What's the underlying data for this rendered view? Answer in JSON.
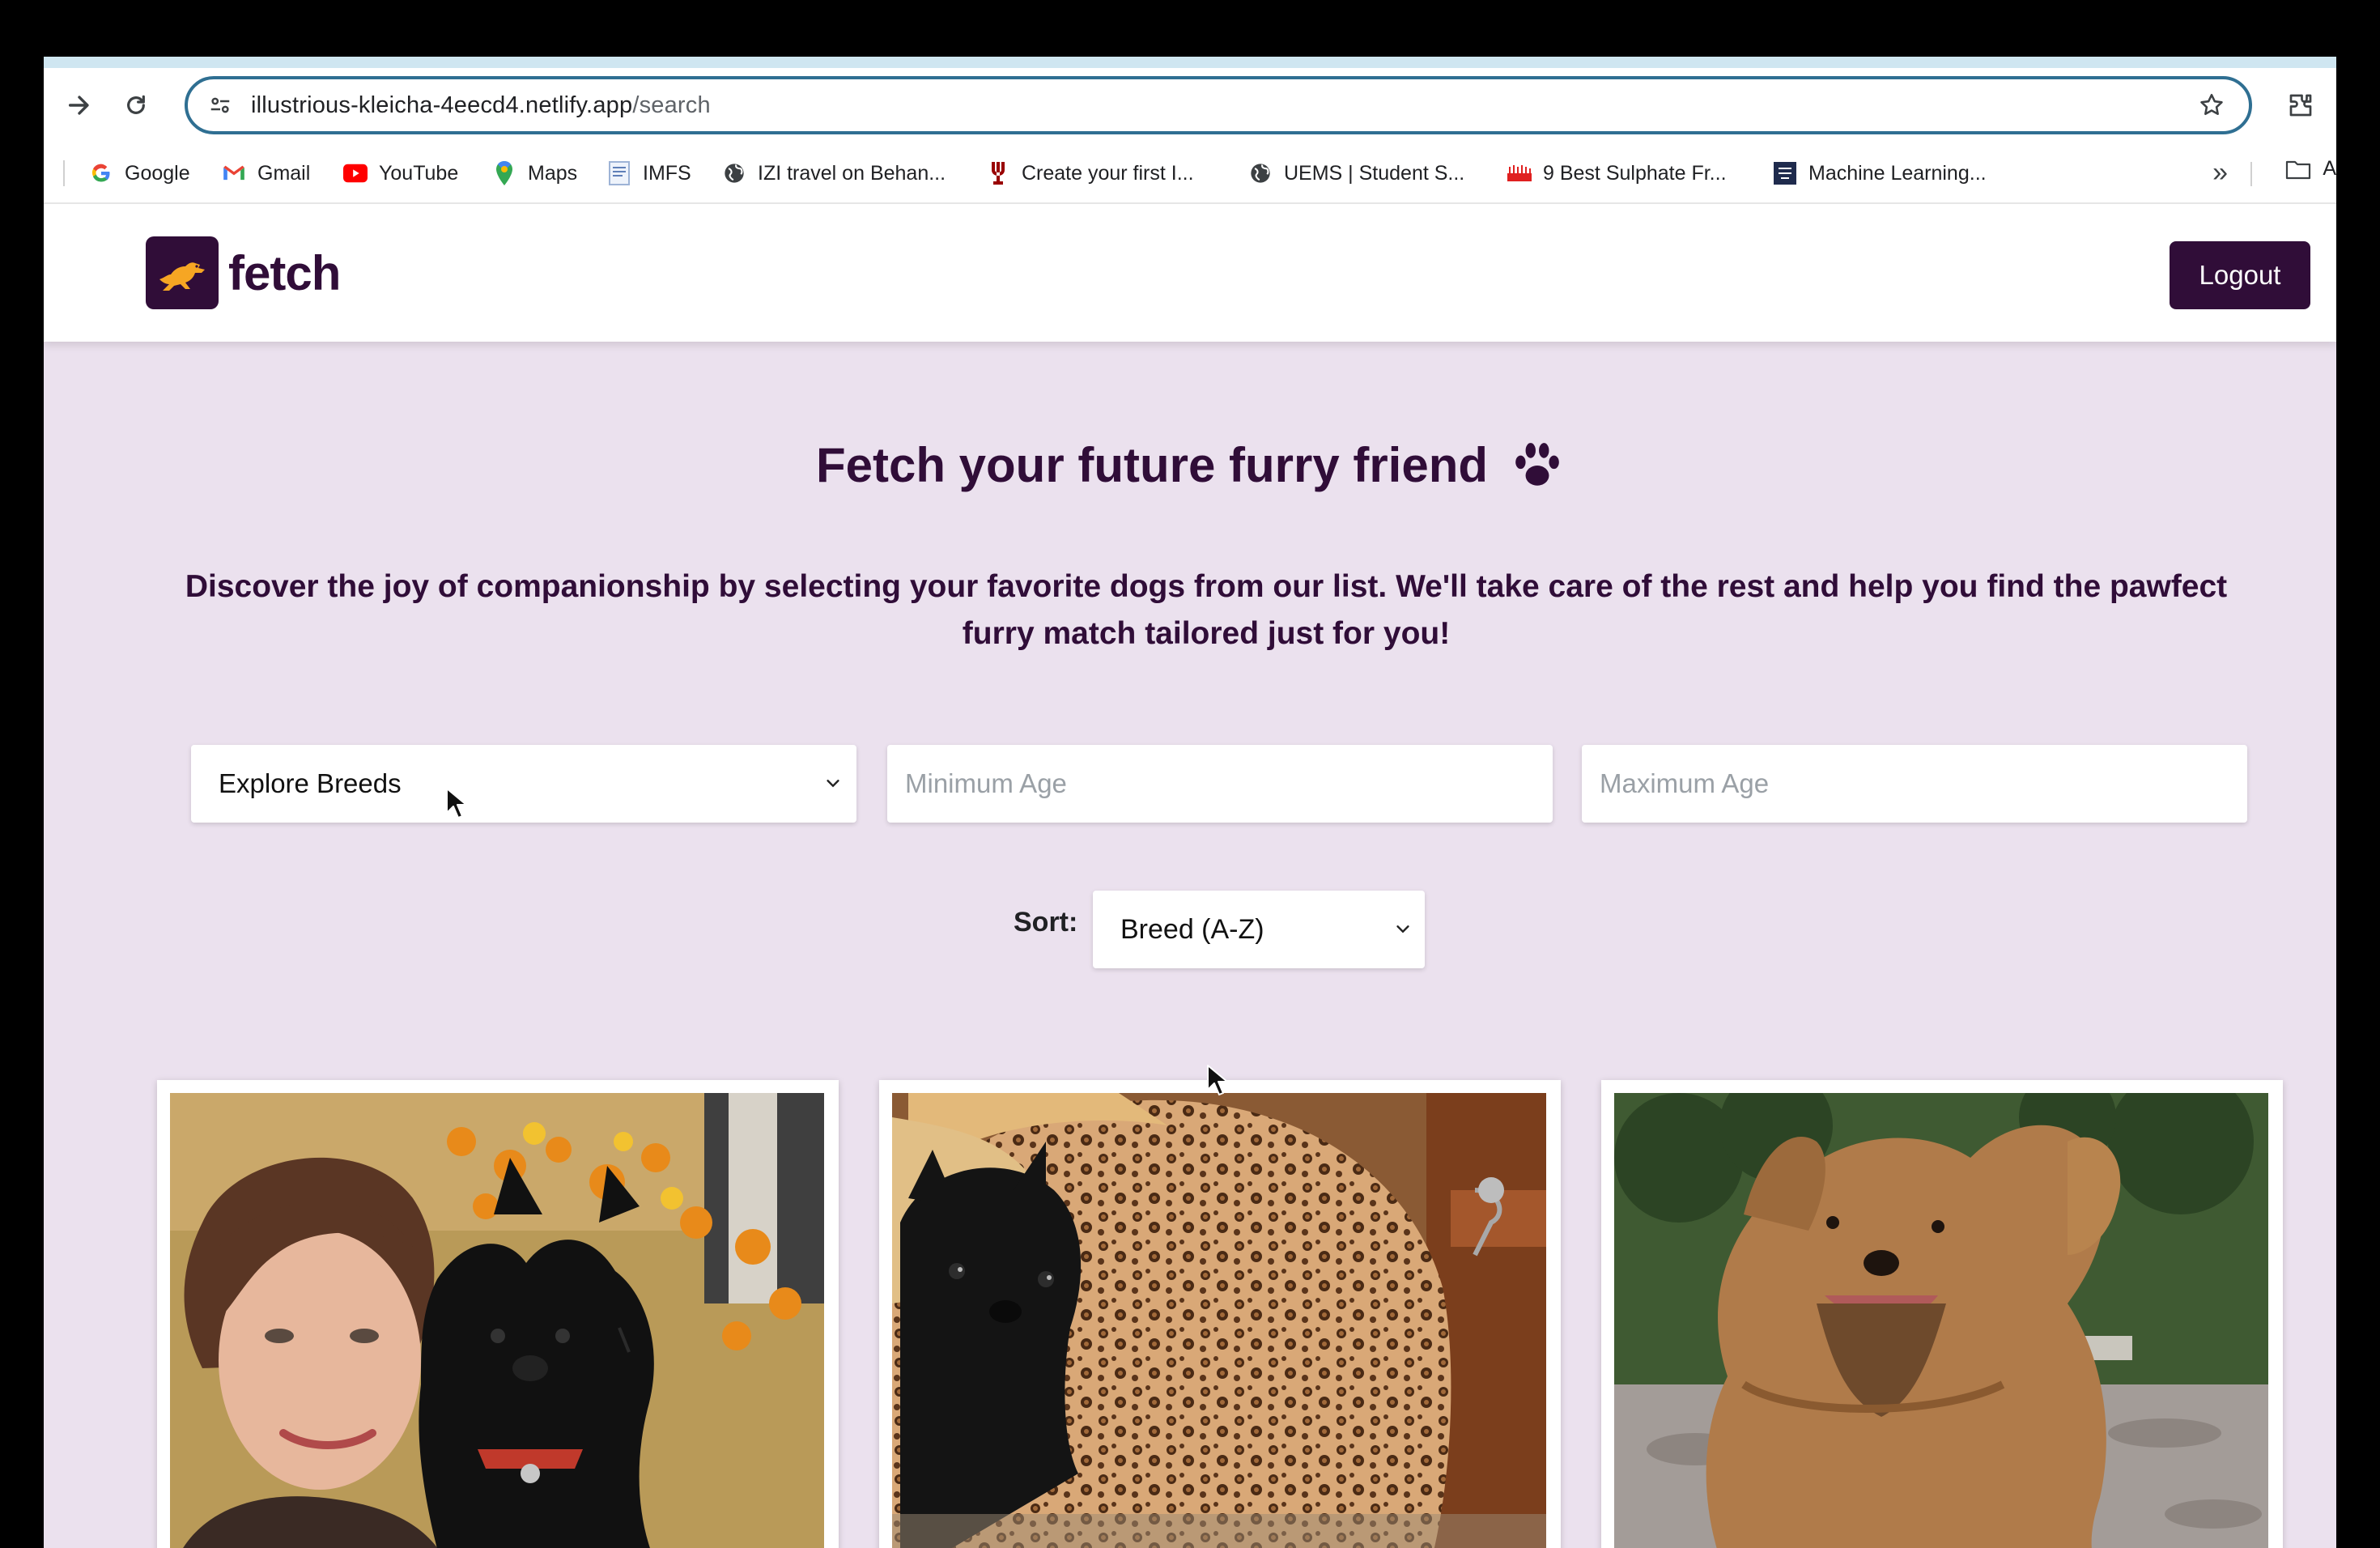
{
  "browser": {
    "url_host": "illustrious-kleicha-4eecd4.netlify.app",
    "url_path": "/search",
    "bookmarks": [
      {
        "label": "Google",
        "icon": "google-icon"
      },
      {
        "label": "Gmail",
        "icon": "gmail-icon"
      },
      {
        "label": "YouTube",
        "icon": "youtube-icon"
      },
      {
        "label": "Maps",
        "icon": "maps-icon"
      },
      {
        "label": "IMFS",
        "icon": "document-icon"
      },
      {
        "label": "IZI travel on Behan...",
        "icon": "globe-icon"
      },
      {
        "label": "Create your first I...",
        "icon": "trident-icon"
      },
      {
        "label": "UEMS | Student S...",
        "icon": "globe-icon"
      },
      {
        "label": "9 Best Sulphate Fr...",
        "icon": "site-icon"
      },
      {
        "label": "Machine Learning...",
        "icon": "site-icon"
      }
    ],
    "bookmarks_overflow": "A"
  },
  "header": {
    "logo_text": "fetch",
    "logout_label": "Logout"
  },
  "hero": {
    "title": "Fetch your future furry friend",
    "subtitle": "Discover the joy of companionship by selecting your favorite dogs from our list. We'll take care of the rest and help you find the pawfect furry match tailored just for you!"
  },
  "filters": {
    "breed_selected": "Explore Breeds",
    "min_age_placeholder": "Minimum Age",
    "max_age_placeholder": "Maximum Age"
  },
  "sort": {
    "label": "Sort:",
    "selected": "Breed (A-Z)"
  },
  "colors": {
    "brand": "#300d38",
    "page_bg": "#ebe1ee",
    "accent": "#f6a623"
  }
}
